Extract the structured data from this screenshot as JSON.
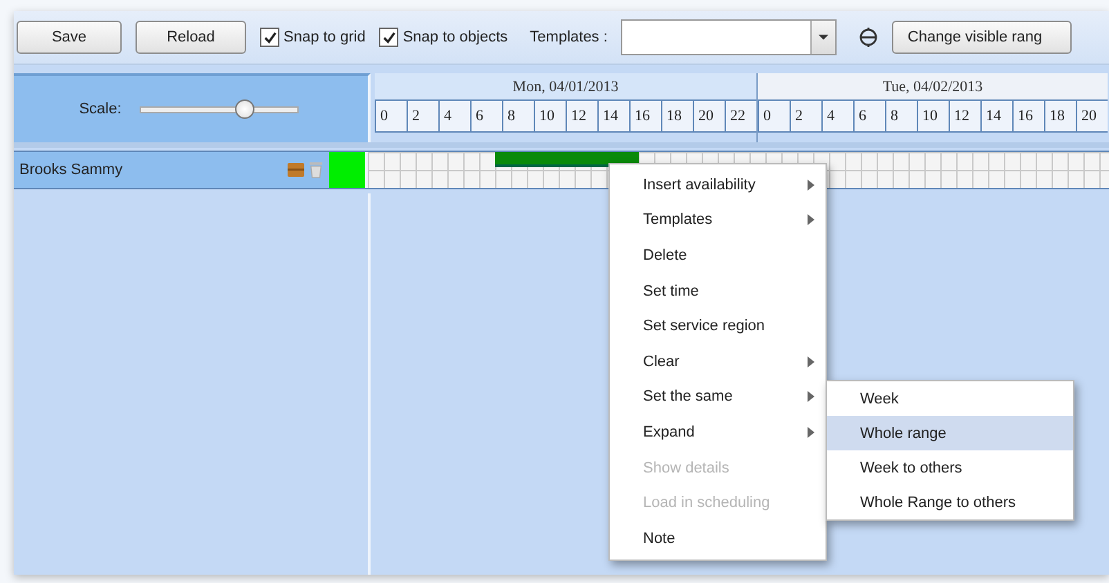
{
  "toolbar": {
    "buttons": [
      {
        "label": "Save"
      },
      {
        "label": "Reload"
      }
    ],
    "checkboxes": [
      {
        "label": "Snap to grid",
        "checked": true
      },
      {
        "label": "Snap to objects",
        "checked": true
      }
    ],
    "templates": {
      "label": "Templates :"
    },
    "range_button": {
      "label": "Change visible rang"
    }
  },
  "scale": {
    "label": "Scale:",
    "level": 0.65
  },
  "days": [
    {
      "label": "Mon, 04/01/2013",
      "hours": [
        "0",
        "2",
        "4",
        "6",
        "8",
        "10",
        "12",
        "14",
        "16",
        "18",
        "20",
        "22"
      ]
    },
    {
      "label": "Tue, 04/02/2013",
      "hours": [
        "0",
        "2",
        "4",
        "6",
        "8",
        "10",
        "12",
        "14",
        "16",
        "18",
        "20"
      ]
    }
  ],
  "resources": [
    {
      "name": "Brooks Sammy",
      "color": "#00ee00"
    }
  ],
  "context_menu": [
    {
      "label": "Insert availability",
      "submenu": true,
      "disabled": false
    },
    {
      "label": "Templates",
      "submenu": true,
      "disabled": false
    },
    {
      "label": "Delete",
      "submenu": false,
      "disabled": false
    },
    {
      "label": "Set time",
      "submenu": false,
      "disabled": false
    },
    {
      "label": "Set service region",
      "submenu": false,
      "disabled": false
    },
    {
      "label": "Clear",
      "submenu": true,
      "disabled": false
    },
    {
      "label": "Set the same",
      "submenu": true,
      "disabled": false
    },
    {
      "label": "Expand",
      "submenu": true,
      "disabled": false
    },
    {
      "label": "Show details",
      "submenu": false,
      "disabled": true
    },
    {
      "label": "Load in scheduling",
      "submenu": false,
      "disabled": true
    },
    {
      "label": "Note",
      "submenu": false,
      "disabled": false
    }
  ],
  "submenu": [
    {
      "label": "Week",
      "selected": false
    },
    {
      "label": "Whole range",
      "selected": true
    },
    {
      "label": "Week to others",
      "selected": false
    },
    {
      "label": "Whole Range to others",
      "selected": false
    }
  ]
}
